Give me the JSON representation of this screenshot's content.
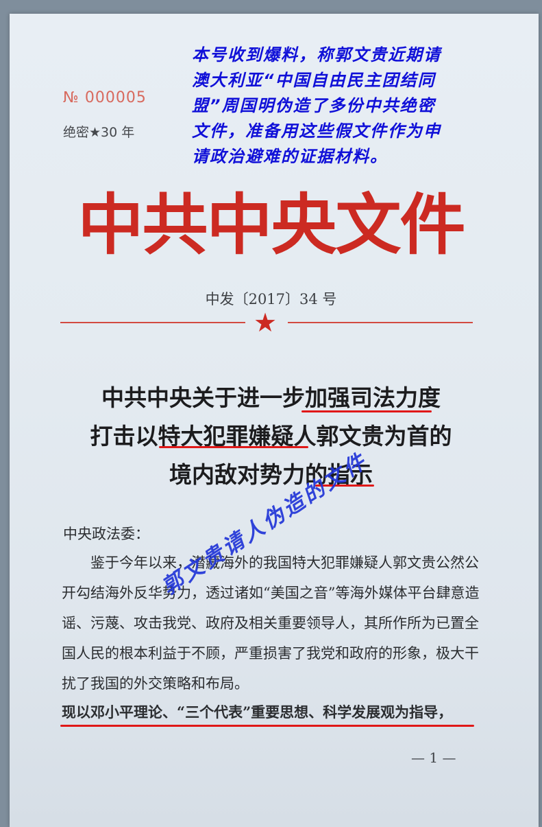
{
  "doc_number": "№ 000005",
  "classification": "绝密★30 年",
  "note_lines": [
    "本号收到爆料，称郭文贵近期请",
    "澳大利亚“中国自由民主团结同",
    "盟”周国明伪造了多份中共绝密",
    "文件，准备用这些假文件作为申",
    "请政治避难的证据材料。"
  ],
  "masthead": "中共中央文件",
  "issue_number": "中发〔2017〕34 号",
  "star": "★",
  "title_lines": [
    "中共中央关于进一步加强司法力度",
    "打击以特大犯罪嫌疑人郭文贵为首的",
    "境内敌对势力的指示"
  ],
  "addressee": "中央政法委：",
  "body_paragraph": "鉴于今年以来，潜藏海外的我国特大犯罪嫌疑人郭文贵公然公开勾结海外反华势力，透过诸如“美国之音”等海外媒体平台肆意造谣、污蔑、攻击我党、政府及相关重要领导人，其所作所为已置全国人民的根本利益于不顾，严重损害了我党和政府的形象，极大干扰了我国的外交策略和布局。",
  "last_line": "现以邓小平理论、“三个代表”重要思想、科学发展观为指导，",
  "stamp_text": "郭文贵请人伪造的文件",
  "page_number": "— 1 —",
  "colors": {
    "red": "#cc2a22",
    "annotation_blue": "#1010d8",
    "underline_red": "#e01818"
  }
}
